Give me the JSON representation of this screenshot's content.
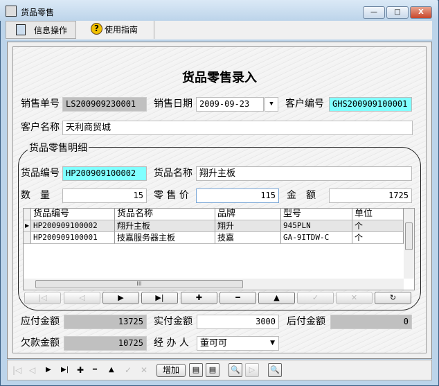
{
  "window": {
    "title": "货品零售",
    "min": "—",
    "max": "□",
    "close": "X"
  },
  "tabs": [
    {
      "label": "信息操作",
      "icon": "book-icon"
    },
    {
      "label": "使用指南",
      "icon": "help-icon"
    }
  ],
  "form": {
    "heading": "货品零售录入",
    "sale_no_label": "销售单号",
    "sale_no": "LS200909230001",
    "sale_date_label": "销售日期",
    "sale_date": "2009-09-23",
    "customer_no_label": "客户编号",
    "customer_no": "GHS200909100001",
    "customer_name_label": "客户名称",
    "customer_name": "天利商贸城",
    "group_title": "货品零售明细",
    "goods_no_label": "货品编号",
    "goods_no": "HP200909100002",
    "goods_name_label": "货品名称",
    "goods_name": "翔升主板",
    "qty_label": "数　量",
    "qty": "15",
    "price_label": "零 售 价",
    "price": "115",
    "amount_label": "金　额",
    "amount": "1725",
    "payable_label": "应付金额",
    "payable": "13725",
    "paid_label": "实付金额",
    "paid": "3000",
    "later_label": "后付金额",
    "later": "0",
    "owed_label": "欠款金额",
    "owed": "10725",
    "handler_label": "经 办 人",
    "handler": "董可可"
  },
  "grid": {
    "columns": [
      "货品编号",
      "货品名称",
      "品牌",
      "型号",
      "单位"
    ],
    "rows": [
      [
        "HP200909100002",
        "翔升主板",
        "翔升",
        "945PLN",
        "个"
      ],
      [
        "HP200909100001",
        "技嘉服务器主板",
        "技嘉",
        "GA-9ITDW-C",
        "个"
      ]
    ],
    "hscroll_grip": "III"
  },
  "navigator": [
    "|◁",
    "◁",
    "▶",
    "▶|",
    "✚",
    "━",
    "▲",
    "✓",
    "✕",
    "↻"
  ],
  "toolbar": {
    "nav": [
      "|◁",
      "◁",
      "▶",
      "▶|",
      "✚",
      "━",
      "▲",
      "✓",
      "✕"
    ],
    "add_label": "增加"
  }
}
